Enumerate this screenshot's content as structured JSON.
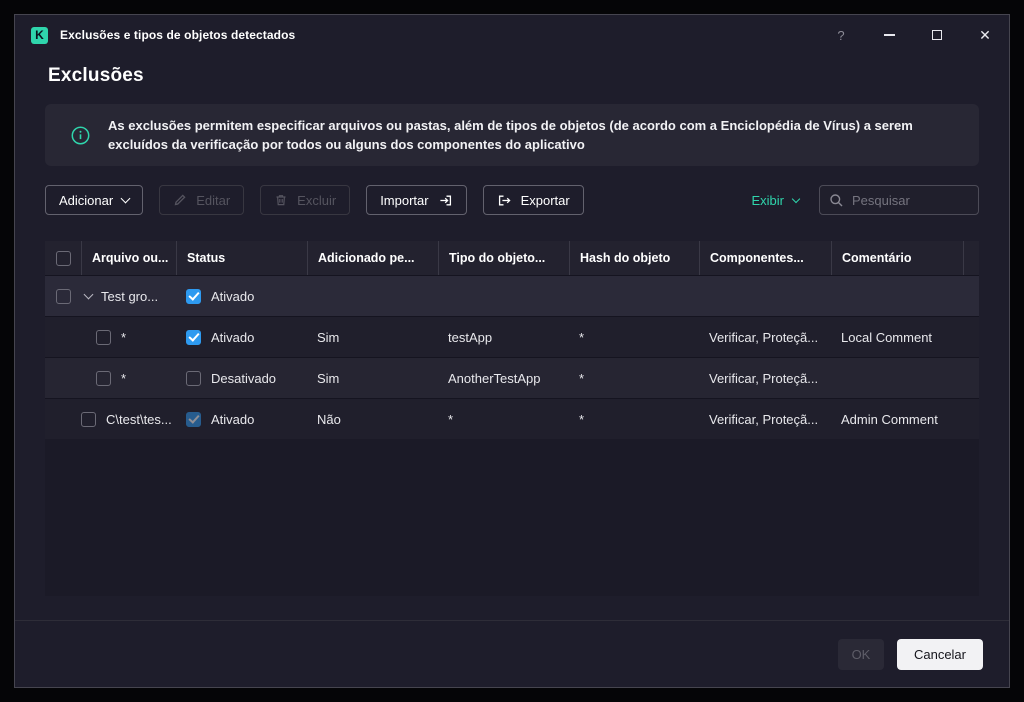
{
  "colors": {
    "accent": "#2fd5ac",
    "checkbox": "#2e9af0"
  },
  "window": {
    "logo_letter": "K",
    "title": "Exclusões e tipos de objetos detectados",
    "controls": {
      "help": "?",
      "close": "✕"
    }
  },
  "page": {
    "heading": "Exclusões",
    "info_text": "As exclusões permitem especificar arquivos ou pastas, além de tipos de objetos (de acordo com a Enciclopédia de Vírus) a serem excluídos da verificação por todos ou alguns dos componentes do aplicativo"
  },
  "toolbar": {
    "add_label": "Adicionar",
    "edit_label": "Editar",
    "delete_label": "Excluir",
    "import_label": "Importar",
    "export_label": "Exportar",
    "view_label": "Exibir",
    "search_placeholder": "Pesquisar"
  },
  "table": {
    "columns": [
      "Arquivo ou...",
      "Status",
      "Adicionado pe...",
      "Tipo do objeto...",
      "Hash do objeto",
      "Componentes...",
      "Comentário"
    ],
    "group": {
      "name": "Test gro...",
      "status_label": "Ativado",
      "status_checked": true
    },
    "rows": [
      {
        "file": "*",
        "status_label": "Ativado",
        "status_checked": true,
        "added_by": "Sim",
        "object_type": "testApp",
        "hash": "*",
        "components": "Verificar, Proteçã...",
        "comment": "Local Comment"
      },
      {
        "file": "*",
        "status_label": "Desativado",
        "status_checked": false,
        "added_by": "Sim",
        "object_type": "AnotherTestApp",
        "hash": "*",
        "components": "Verificar, Proteçã...",
        "comment": ""
      },
      {
        "file": "C\\test\\tes...",
        "status_label": "Ativado",
        "status_checked": true,
        "added_by": "Não",
        "object_type": "*",
        "hash": "*",
        "components": "Verificar, Proteçã...",
        "comment": "Admin Comment"
      }
    ]
  },
  "footer": {
    "ok_label": "OK",
    "cancel_label": "Cancelar"
  }
}
